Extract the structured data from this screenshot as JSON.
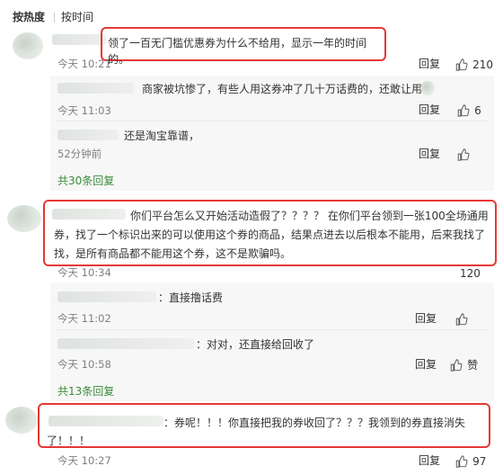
{
  "tabs": {
    "by_hot": "按热度",
    "by_time": "按时间"
  },
  "c1": {
    "text": "领了一百无门槛优惠券为什么不给用，显示一年的时间的。",
    "time": "今天 10:21",
    "reply": "回复",
    "likes": "210"
  },
  "r1": {
    "text": "商家被坑惨了，有些人用这券冲了几十万话费的，还敢让用吗",
    "time": "今天 11:03",
    "reply": "回复",
    "likes": "6"
  },
  "r2": {
    "text": "还是淘宝靠谱，",
    "time": "52分钟前",
    "reply": "回复",
    "likes": ""
  },
  "more1": "共30条回复",
  "c2": {
    "text": "你们平台怎么又开始活动造假了？？？？ 在你们平台领到一张100全场通用券，找了一个标识出来的可以使用这个券的商品，结果点进去以后根本不能用，后来我找了找，是所有商品都不能用这个券，这不是欺骗吗。",
    "time": "今天 10:34",
    "likes": "120"
  },
  "r3": {
    "text": "：直接撸话费",
    "time": "今天 11:02",
    "reply": "回复",
    "likes": ""
  },
  "r4": {
    "text": "：对对，还直接给回收了",
    "time": "今天 10:58",
    "reply": "回复",
    "like_label": "赞"
  },
  "more2": "共13条回复",
  "c3": {
    "text": "：券呢！！！你直接把我的券收回了？？？我领到的券直接消失了！！！",
    "time": "今天 10:27",
    "reply": "回复",
    "likes": "97"
  },
  "colors": {
    "highlight": "#e53935",
    "link_green": "#3a8b3a"
  }
}
